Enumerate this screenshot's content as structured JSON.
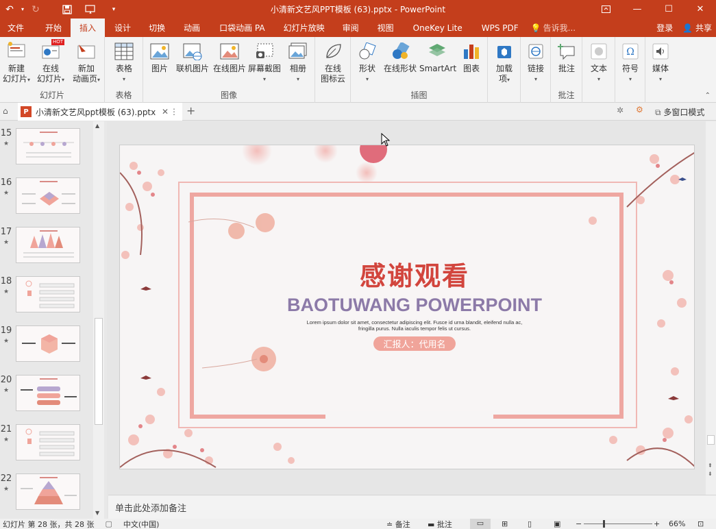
{
  "app": {
    "title": "小清新文艺风PPT模板 (63).pptx - PowerPoint"
  },
  "tabs": [
    "文件",
    "开始",
    "插入",
    "设计",
    "切换",
    "动画",
    "口袋动画 PA",
    "幻灯片放映",
    "审阅",
    "视图",
    "OneKey Lite",
    "WPS PDF"
  ],
  "tell_me": "告诉我...",
  "login": "登录",
  "share": "共享",
  "ribbon": {
    "groups": {
      "slides": "幻灯片",
      "tables": "表格",
      "images": "图像",
      "illustrations": "插图",
      "comments": "批注"
    },
    "buttons": {
      "new_slide": [
        "新建",
        "幻灯片"
      ],
      "online_slide": [
        "在线",
        "幻灯片"
      ],
      "new_anim": [
        "新加",
        "动画页"
      ],
      "hot": "HOT",
      "table": "表格",
      "picture": "图片",
      "online_pic": "联机图片",
      "online_picture": "在线图片",
      "screenshot": "屏幕截图",
      "album": "相册",
      "online_icon": [
        "在线",
        "图标云"
      ],
      "shapes": "形状",
      "online_shapes": "在线形状",
      "smartart": "SmartArt",
      "chart": "图表",
      "addins": [
        "加载",
        "项"
      ],
      "link": "链接",
      "comment": "批注",
      "text": "文本",
      "symbol": "符号",
      "media": "媒体"
    }
  },
  "doc_tab": "小清新文艺风ppt模板 (63).pptx",
  "multiwindow": "多窗口模式",
  "thumbnails": [
    {
      "num": "15"
    },
    {
      "num": "16"
    },
    {
      "num": "17"
    },
    {
      "num": "18"
    },
    {
      "num": "19"
    },
    {
      "num": "20"
    },
    {
      "num": "21"
    },
    {
      "num": "22"
    }
  ],
  "slide": {
    "title": "感谢观看",
    "subtitle": "BAOTUWANG POWERPOINT",
    "body_line1": "Lorem ipsum dolor sit amet, consectetur adipiscing elit. Fusce id urna blandit, eleifend nulla ac,",
    "body_line2": "fringilla purus. Nulla iaculis tempor felis ut cursus.",
    "reporter": "汇报人：代用名"
  },
  "notes_placeholder": "单击此处添加备注",
  "status": {
    "slide_info": "幻灯片 第 28 张，共 28 张",
    "language": "中文(中国)",
    "notes": "备注",
    "comments": "批注",
    "zoom": "66%"
  },
  "colors": {
    "accent": "#c43e1c",
    "slide_title": "#d2453d",
    "slide_subtitle": "#8c7aa8",
    "reporter_bg": "#f0a49a"
  }
}
